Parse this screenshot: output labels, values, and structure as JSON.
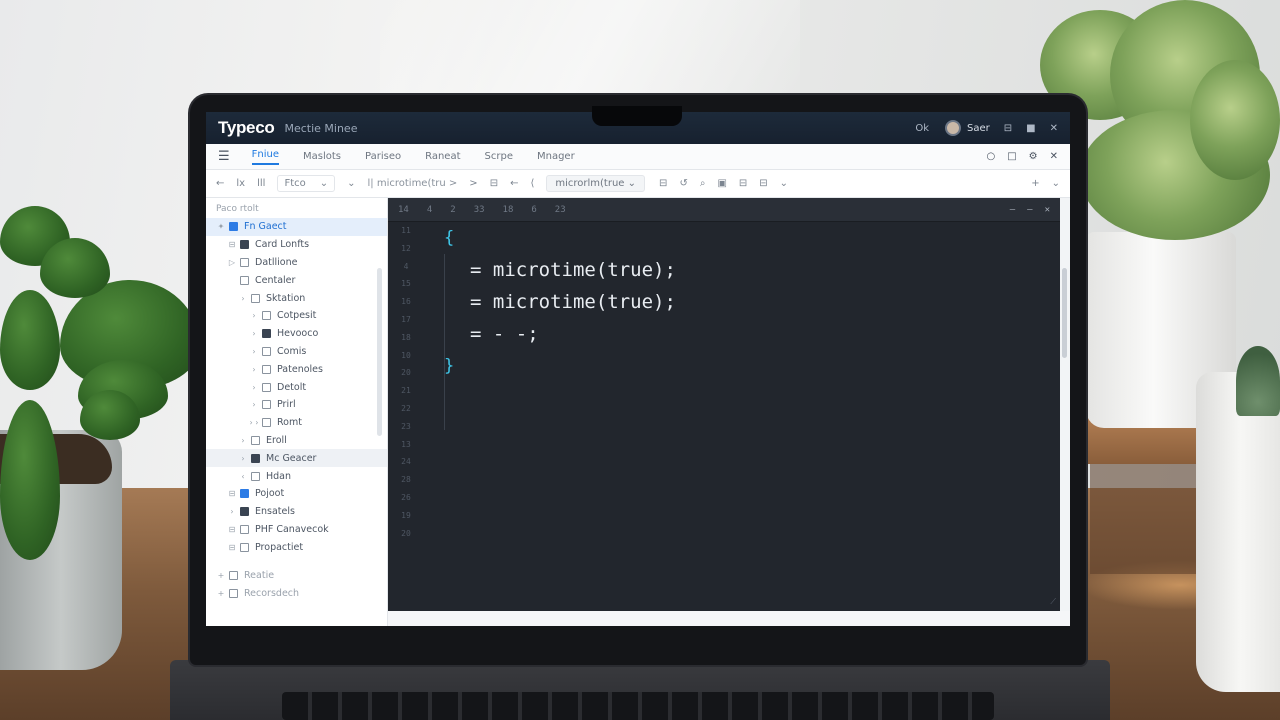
{
  "titlebar": {
    "app_name": "Typeco",
    "subtitle": "Mectie Minee",
    "item1": "Ok",
    "user": "Saer",
    "btn1": "⊟",
    "btn2": "■",
    "close": "✕"
  },
  "menu": {
    "hamburger": "☰",
    "items": [
      "Fniue",
      "Maslots",
      "Pariseo",
      "Raneat",
      "Scrpe",
      "Mnager"
    ],
    "icons": [
      "○",
      "□",
      "⚙",
      "✕"
    ]
  },
  "toolbar": {
    "back": "←",
    "tool1": "lx",
    "tool2": "lll",
    "dropdown_label": "Ftco",
    "dropdown_chev": "⌄",
    "more": "⌄",
    "crumb": "l| microtime(tru >",
    "crumb_arrow": ">",
    "nav1": "⊟",
    "nav2": "←",
    "nav3": "⟨",
    "file_tab": "microrlm(true",
    "file_tab_chev": "⌄",
    "icons": [
      "⊟",
      "↺",
      "⌕",
      "▣",
      "⊟",
      "⊟",
      "⌄"
    ],
    "plus": "+",
    "right_chev": "⌄"
  },
  "sidebar": {
    "header": "Paco rtolt",
    "items": [
      {
        "label": "Fn Gaect",
        "chev": "✦",
        "icon": "blue",
        "level": 0
      },
      {
        "label": "Card Lonfts",
        "chev": "⊟",
        "icon": "fill",
        "level": 1
      },
      {
        "label": "Datllione",
        "chev": "▷",
        "icon": "",
        "level": 1
      },
      {
        "label": "Centaler",
        "chev": "",
        "icon": "",
        "level": 1
      },
      {
        "label": "Sktation",
        "chev": "›",
        "icon": "",
        "level": 2
      },
      {
        "label": "Cotpesit",
        "chev": "›",
        "icon": "",
        "level": 3
      },
      {
        "label": "Hevooco",
        "chev": "›",
        "icon": "fill",
        "level": 3
      },
      {
        "label": "Comis",
        "chev": "›",
        "icon": "",
        "level": 3
      },
      {
        "label": "Patenoles",
        "chev": "›",
        "icon": "",
        "level": 3
      },
      {
        "label": "Detolt",
        "chev": "›",
        "icon": "",
        "level": 3
      },
      {
        "label": "Prirl",
        "chev": "›",
        "icon": "",
        "level": 3
      },
      {
        "label": "Romt",
        "chev": "› ›",
        "icon": "",
        "level": 3
      },
      {
        "label": "Eroll",
        "chev": "›",
        "icon": "",
        "level": 2
      },
      {
        "label": "Mc Geacer",
        "chev": "›",
        "icon": "fill",
        "level": 2
      },
      {
        "label": "Hdan",
        "chev": "‹",
        "icon": "",
        "level": 2
      },
      {
        "label": "Pojoot",
        "chev": "⊟",
        "icon": "blue",
        "level": 1
      },
      {
        "label": "Ensatels",
        "chev": "›",
        "icon": "fill",
        "level": 1
      },
      {
        "label": "PHF Canavecok",
        "chev": "⊟",
        "icon": "",
        "level": 1
      },
      {
        "label": "Propactiet",
        "chev": "⊟",
        "icon": "",
        "level": 1
      }
    ],
    "footer": [
      {
        "label": "Reatie",
        "chev": "+"
      },
      {
        "label": "Recorsdech",
        "chev": "+"
      }
    ]
  },
  "editor": {
    "tabs": [
      "14",
      "4",
      "2",
      "33",
      "18",
      "6",
      "23"
    ],
    "controls": [
      "—",
      "—",
      "✕"
    ],
    "line_numbers": [
      "11",
      "12",
      "4",
      "15",
      "16",
      "17",
      "18",
      "10",
      "20",
      "21",
      "22",
      "23",
      "13",
      "24",
      "28",
      "26",
      "19",
      "20"
    ],
    "code": [
      {
        "text": "{",
        "kind": "brace"
      },
      {
        "text": "= microtime(true);",
        "kind": "indent"
      },
      {
        "text": "= microtime(true);",
        "kind": "indent"
      },
      {
        "text": "= - -;",
        "kind": "indent"
      },
      {
        "text": "}",
        "kind": "brace"
      }
    ],
    "resize": "⟋"
  },
  "colors": {
    "accent": "#1f7ae0",
    "editor_bg": "#22262d",
    "brace": "#3fc6e8",
    "titlebar": "#1d2a3a"
  }
}
